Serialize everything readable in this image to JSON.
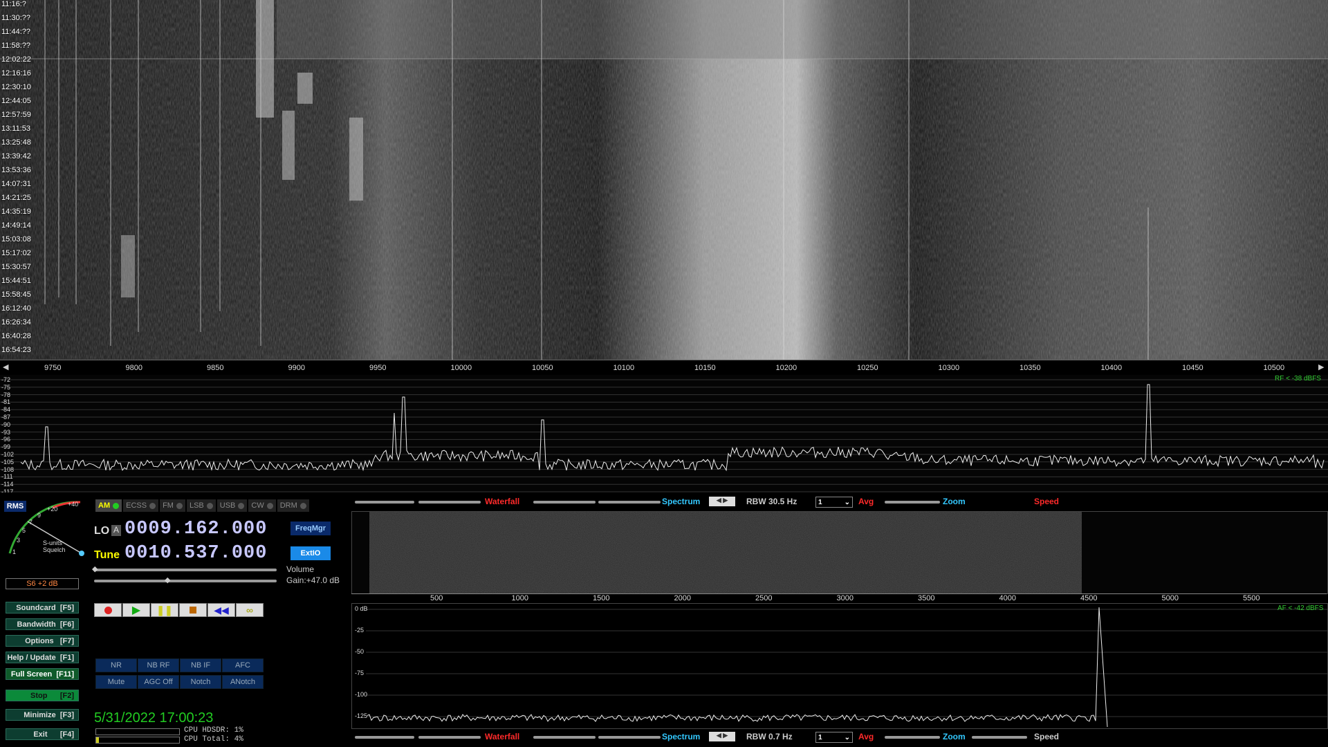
{
  "waterfall": {
    "timestamps": [
      "11:16:?",
      "11:30:??",
      "11:44:??",
      "11:58:??",
      "12:02:22",
      "12:16:16",
      "12:30:10",
      "12:44:05",
      "12:57:59",
      "13:11:53",
      "13:25:48",
      "13:39:42",
      "13:53:36",
      "14:07:31",
      "14:21:25",
      "14:35:19",
      "14:49:14",
      "15:03:08",
      "15:17:02",
      "15:30:57",
      "15:44:51",
      "15:58:45",
      "16:12:40",
      "16:26:34",
      "16:40:28",
      "16:54:23"
    ],
    "freq_ticks": [
      "9750",
      "9800",
      "9850",
      "9900",
      "9950",
      "10000",
      "10050",
      "10100",
      "10150",
      "10200",
      "10250",
      "10300",
      "10350",
      "10400",
      "10450",
      "10500"
    ]
  },
  "spectrum": {
    "db_ticks": [
      "-72",
      "-75",
      "-78",
      "-81",
      "-84",
      "-87",
      "-90",
      "-93",
      "-96",
      "-99",
      "-102",
      "-105",
      "-108",
      "-111",
      "-114",
      "-117"
    ],
    "rf_label": "RF < -38 dBFS"
  },
  "smeter": {
    "mode_label": "RMS",
    "scale": [
      "1",
      "3",
      "5",
      "7",
      "9",
      "+20",
      "+40"
    ],
    "units_label": "S-units",
    "squelch_label": "Squelch",
    "reading": "S6 +2 dB"
  },
  "modes": {
    "items": [
      "AM",
      "ECSS",
      "FM",
      "LSB",
      "USB",
      "CW",
      "DRM"
    ],
    "active": "AM"
  },
  "tuning": {
    "lo_label": "LO",
    "lo_slot": "A",
    "lo_value": "0009.162.000",
    "tune_label": "Tune",
    "tune_value": "0010.537.000",
    "freqmgr": "FreqMgr",
    "extio": "ExtIO",
    "volume_label": "Volume",
    "gain_label": "Gain:+47.0 dB"
  },
  "left_buttons": [
    {
      "label": "Soundcard  [F5]",
      "style": "dark"
    },
    {
      "label": "Bandwidth  [F6]",
      "style": "dark"
    },
    {
      "label": "Options   [F7]",
      "style": "dark"
    },
    {
      "label": "Help / Update  [F1]",
      "style": "dark"
    },
    {
      "label": "Full Screen  [F11]",
      "style": "dark-green"
    },
    {
      "label": "Stop      [F2]",
      "style": "bright"
    },
    {
      "label": "Minimize  [F3]",
      "style": "dark"
    },
    {
      "label": "Exit      [F4]",
      "style": "dark"
    }
  ],
  "dsp": {
    "row1": [
      "NR",
      "NB RF",
      "NB IF",
      "AFC"
    ],
    "row2": [
      "Mute",
      "AGC Off",
      "Notch",
      "ANotch"
    ]
  },
  "status": {
    "datetime": "5/31/2022 17:00:23",
    "cpu_hdsdr": "CPU HDSDR: 1%",
    "cpu_total": "CPU Total: 4%"
  },
  "toolbar_top": {
    "waterfall": "Waterfall",
    "spectrum": "Spectrum",
    "rbw": "RBW 30.5 Hz",
    "avg_value": "1",
    "avg": "Avg",
    "zoom": "Zoom",
    "speed": "Speed"
  },
  "af": {
    "freq_ticks": [
      "500",
      "1000",
      "1500",
      "2000",
      "2500",
      "3000",
      "3500",
      "4000",
      "4500",
      "5000",
      "5500"
    ],
    "db_ticks": [
      "0 dB",
      "-25",
      "-50",
      "-75",
      "-100",
      "-125"
    ],
    "af_label": "AF < -42 dBFS"
  },
  "toolbar_bottom": {
    "waterfall": "Waterfall",
    "spectrum": "Spectrum",
    "rbw": "RBW  0.7 Hz",
    "avg_value": "1",
    "avg": "Avg",
    "zoom": "Zoom",
    "speed": "Speed"
  },
  "colors": {
    "accent_red": "#ff2a2a",
    "accent_cyan": "#33c8ff",
    "lcd": "#c8c8ff",
    "status_green": "#22cc22"
  }
}
